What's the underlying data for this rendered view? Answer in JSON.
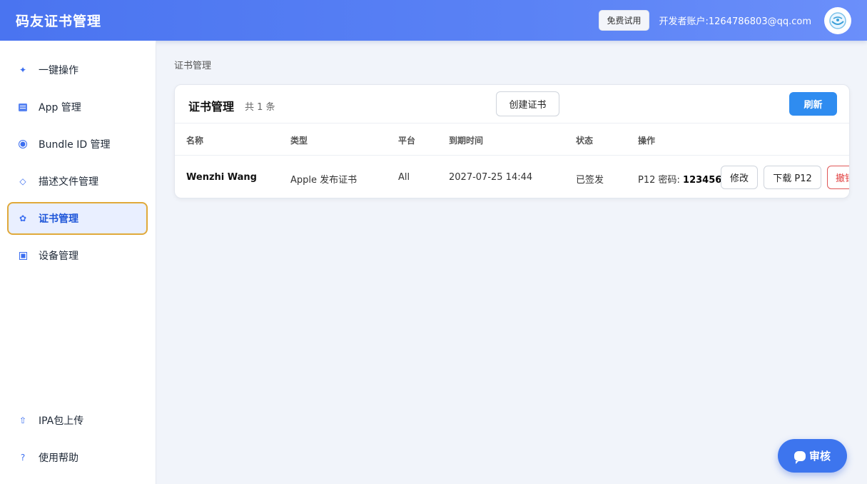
{
  "header": {
    "title": "码友证书管理",
    "trial_label": "免费试用",
    "account_label": "开发者账户:1264786803@qq.com"
  },
  "sidebar": {
    "items": [
      {
        "label": "一键操作",
        "icon": "sparkle-icon"
      },
      {
        "label": "App 管理",
        "icon": "app-list-icon"
      },
      {
        "label": "Bundle ID 管理",
        "icon": "target-icon"
      },
      {
        "label": "描述文件管理",
        "icon": "diamond-icon"
      },
      {
        "label": "证书管理",
        "icon": "flower-icon",
        "active": true
      },
      {
        "label": "设备管理",
        "icon": "device-icon"
      }
    ],
    "bottom_items": [
      {
        "label": "IPA包上传",
        "icon": "upload-arrow-icon"
      },
      {
        "label": "使用帮助",
        "icon": "help-icon"
      }
    ]
  },
  "breadcrumb": "证书管理",
  "card": {
    "title": "证书管理",
    "count": "共 1 条",
    "create_label": "创建证书",
    "refresh_label": "刷新",
    "columns": [
      "名称",
      "类型",
      "平台",
      "到期时间",
      "状态",
      "操作"
    ],
    "rows": [
      {
        "name": "Wenzhi Wang",
        "type": "Apple 发布证书",
        "platform": "All",
        "expires": "2027-07-25 14:44",
        "status": "已签发",
        "p12_label": "P12 密码:",
        "p12_password": "123456",
        "edit_label": "修改",
        "download_label": "下载 P12",
        "revoke_label": "撤销"
      }
    ]
  },
  "fab_label": "审核",
  "colors": {
    "header_gradient_start": "#4a74f0",
    "accent_blue": "#2f8cf0",
    "active_border": "#e0a93a",
    "danger": "#e03b3b"
  }
}
